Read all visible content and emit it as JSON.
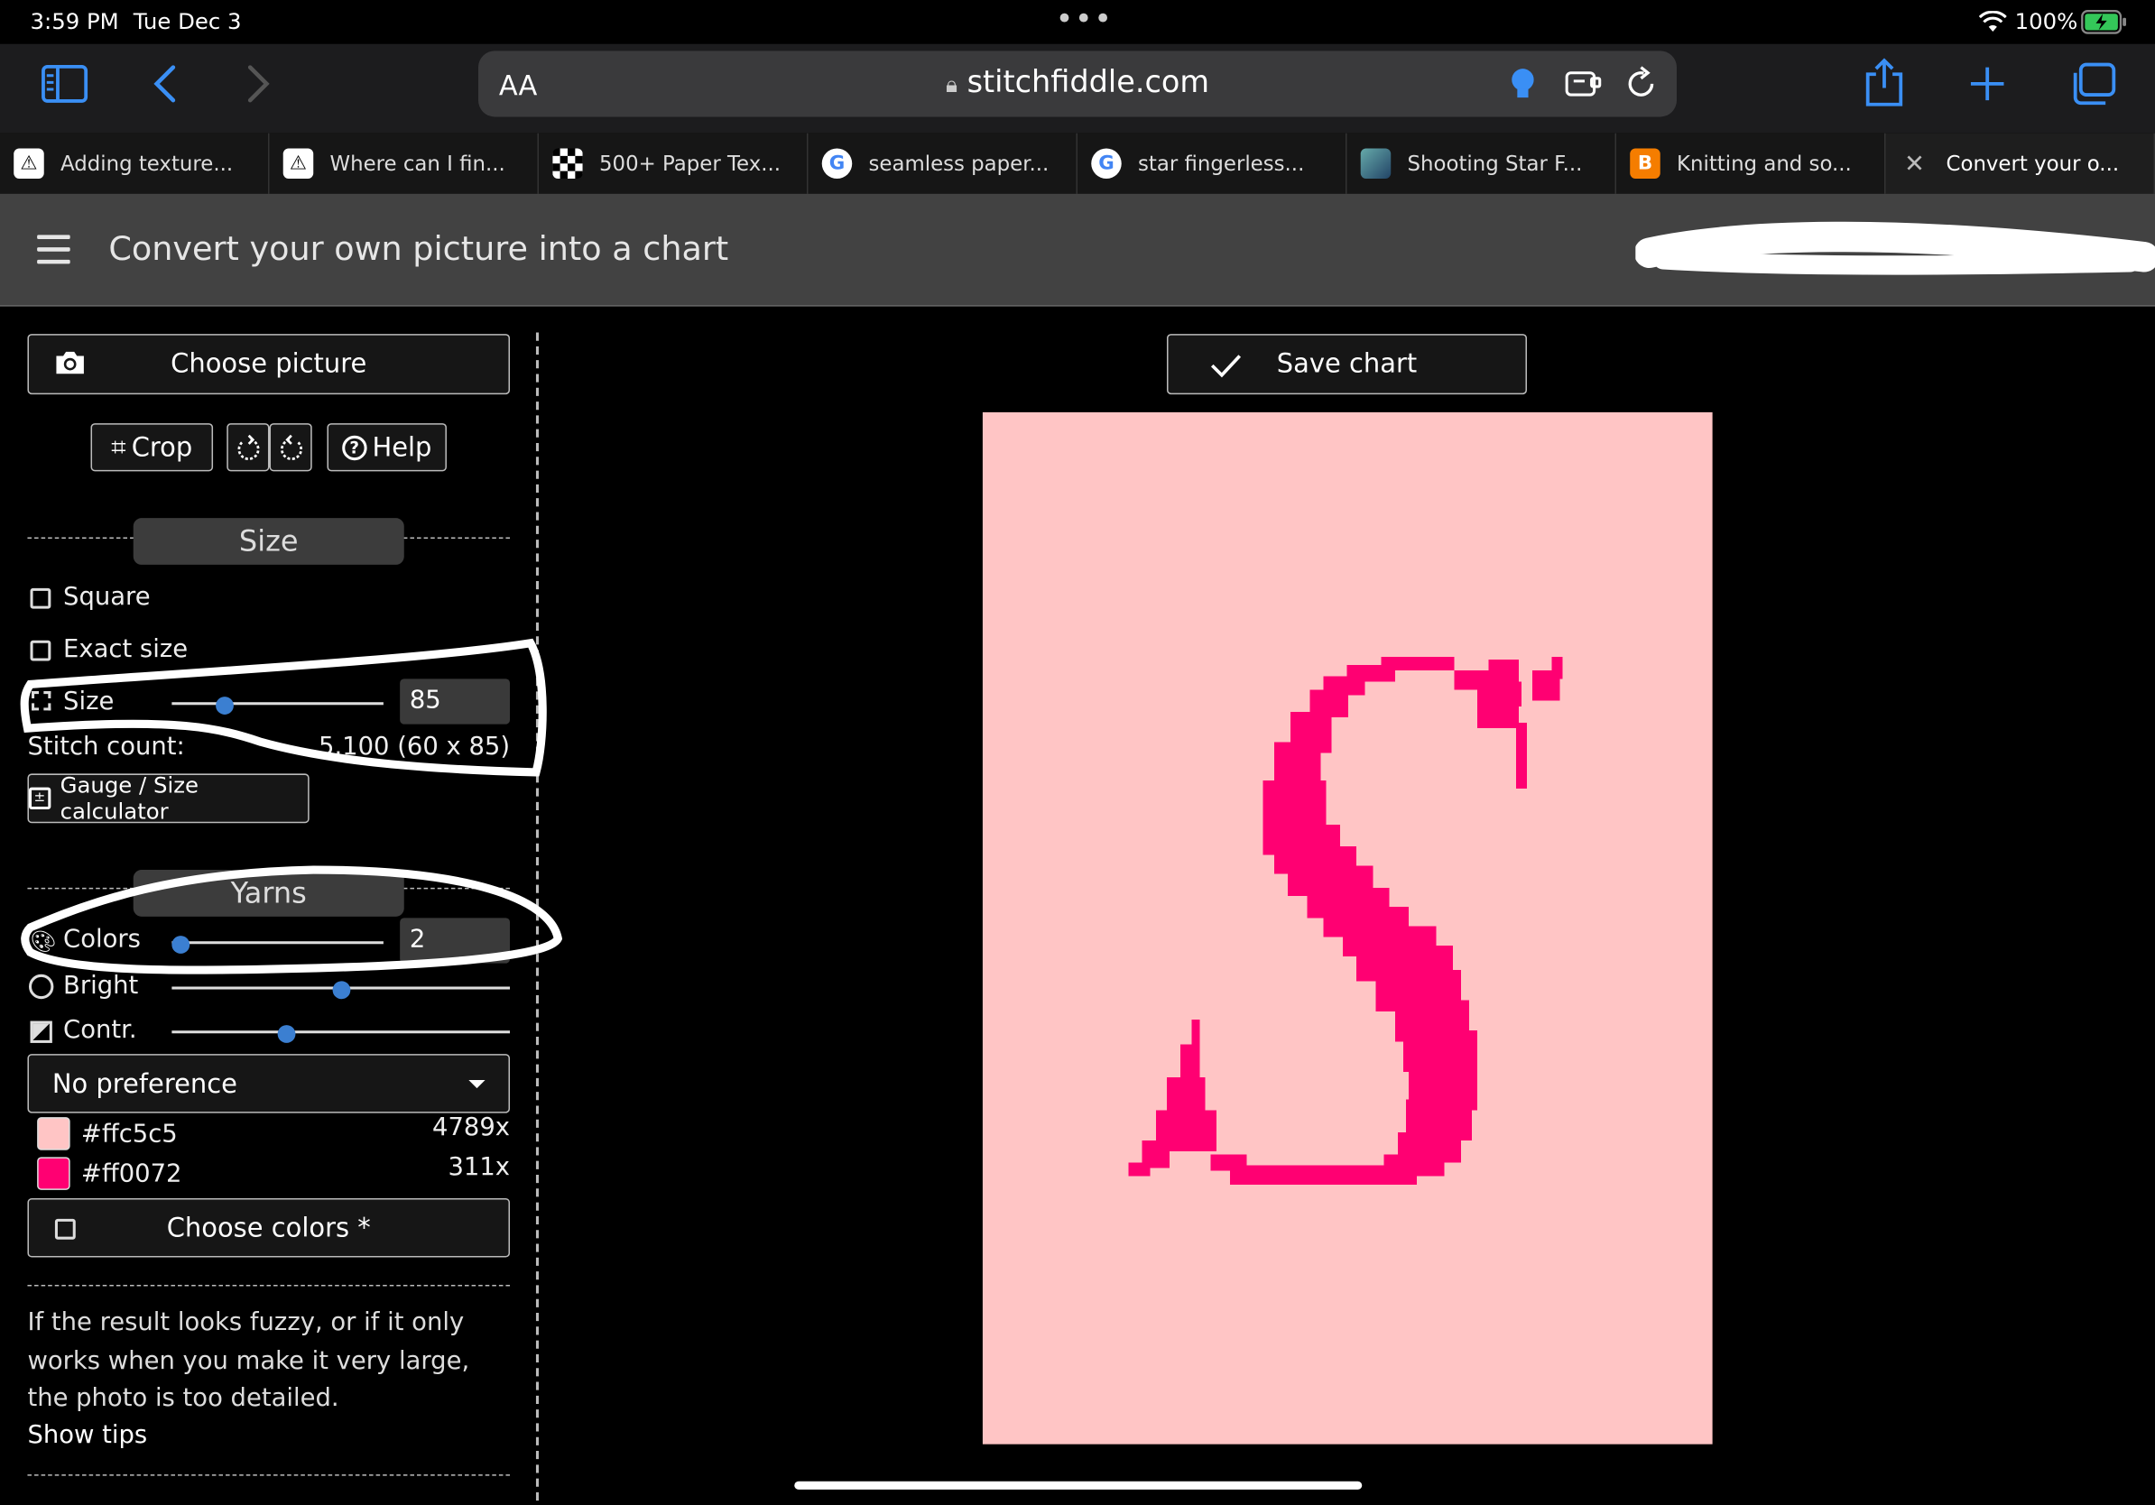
{
  "status": {
    "time": "3:59 PM",
    "date": "Tue Dec 3",
    "battery": "100%"
  },
  "browser": {
    "aa_label": "AA",
    "url": "stitchfiddle.com",
    "tabs": [
      {
        "label": "Adding texture...",
        "icon": "warning-triangle-icon"
      },
      {
        "label": "Where can I fin...",
        "icon": "warning-triangle-icon"
      },
      {
        "label": "500+ Paper Tex...",
        "icon": "checker-icon"
      },
      {
        "label": "seamless paper...",
        "icon": "google-icon"
      },
      {
        "label": "star fingerless...",
        "icon": "google-icon"
      },
      {
        "label": "Shooting Star F...",
        "icon": "photo-icon"
      },
      {
        "label": "Knitting and so...",
        "icon": "blogger-icon"
      },
      {
        "label": "Convert your o...",
        "icon": "close-icon"
      }
    ]
  },
  "app": {
    "title": "Convert your own picture into a chart"
  },
  "panel": {
    "choose_picture": "Choose picture",
    "crop": "Crop",
    "help": "Help",
    "size_section": "Size",
    "square": "Square",
    "exact_size": "Exact size",
    "size_label": "Size",
    "size_value": "85",
    "size_slider": 0.23,
    "stitch_count_label": "Stitch count:",
    "stitch_count_value": "5.100 (60 x 85)",
    "gauge_button": "Gauge / Size calculator",
    "yarns_section": "Yarns",
    "colors_label": "Colors",
    "colors_value": "2",
    "colors_slider": 0.0,
    "bright_label": "Bright",
    "bright_slider": 0.5,
    "contr_label": "Contr.",
    "contr_slider": 0.33,
    "preference": "No preference",
    "palette": [
      {
        "hex": "#ffc5c5",
        "count": "4789x",
        "color": "#ffc5c5"
      },
      {
        "hex": "#ff0072",
        "count": "311x",
        "color": "#ff0072"
      }
    ],
    "choose_colors": "Choose colors *",
    "tip_text": "If the result looks fuzzy, or if it only works when you make it very large, the photo is too detailed.",
    "show_tips": "Show tips"
  },
  "main": {
    "save_chart": "Save chart"
  },
  "colors": {
    "accent": "#3b7fd1",
    "chart_bg": "#ffc5c5",
    "chart_fg": "#ff0072"
  }
}
